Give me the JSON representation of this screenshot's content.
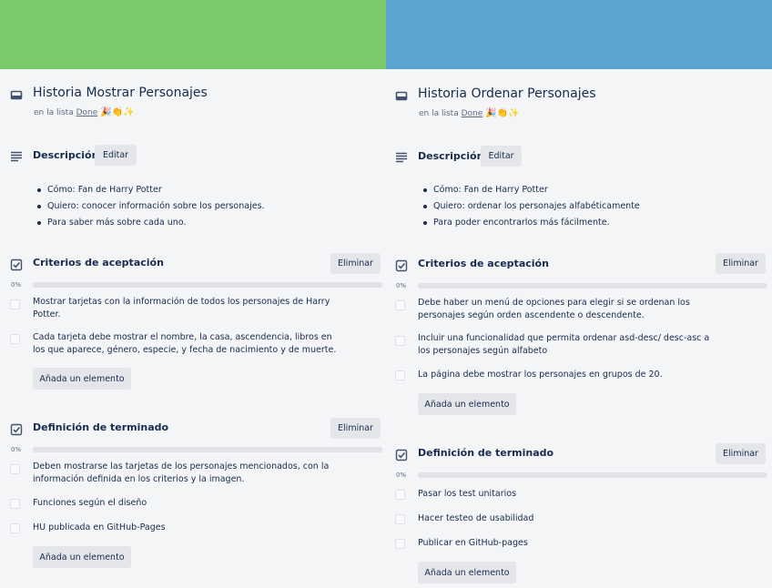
{
  "colors": {
    "left_cover": "#7ac96c",
    "right_cover": "#5ba4cf"
  },
  "cards": [
    {
      "title": "Historia Mostrar Personajes",
      "list_prefix": "en la lista",
      "list_name": "Done",
      "list_emojis": "🎉👏✨",
      "description": {
        "heading": "Descripción",
        "edit_label": "Editar",
        "items": [
          "Cómo: Fan de Harry Potter",
          "Quiero: conocer información sobre los personajes.",
          "Para saber más sobre cada uno."
        ]
      },
      "checklists": [
        {
          "title": "Criterios de aceptación",
          "delete_label": "Eliminar",
          "percent_label": "0%",
          "progress": 0,
          "items": [
            "Mostrar tarjetas con la información de todos los personajes de Harry\nPotter.",
            "Cada tarjeta debe mostrar el nombre, la casa, ascendencia, libros en\nlos que aparece, género, especie, y fecha de nacimiento y de muerte."
          ],
          "add_label": "Añada un elemento"
        },
        {
          "title": "Definición de terminado",
          "delete_label": "Eliminar",
          "percent_label": "0%",
          "progress": 0,
          "items": [
            "Deben mostrarse las tarjetas de los personajes mencionados, con la\ninformación definida en los criterios y la imagen.",
            "Funciones según el diseño",
            "HU publicada en GitHub-Pages"
          ],
          "add_label": "Añada un elemento"
        }
      ]
    },
    {
      "title": "Historia Ordenar Personajes",
      "list_prefix": "en la lista",
      "list_name": "Done",
      "list_emojis": "🎉👏✨",
      "description": {
        "heading": "Descripción",
        "edit_label": "Editar",
        "items": [
          "Cómo: Fan de Harry Potter",
          "Quiero: ordenar los personajes alfabéticamente",
          "Para poder encontrarlos más fácilmente."
        ]
      },
      "checklists": [
        {
          "title": "Criterios de aceptación",
          "delete_label": "Eliminar",
          "percent_label": "0%",
          "progress": 0,
          "items": [
            "Debe haber un menú de opciones para elegir si se ordenan los\npersonajes según orden ascendente o descendente.",
            "Incluir una funcionalidad que permita ordenar asd-desc/ desc-asc a\nlos personajes según alfabeto",
            "La página debe mostrar los personajes en grupos de 20."
          ],
          "add_label": "Añada un elemento"
        },
        {
          "title": "Definición de terminado",
          "delete_label": "Eliminar",
          "percent_label": "0%",
          "progress": 0,
          "items": [
            "Pasar los test unitarios",
            "Hacer testeo de usabilidad",
            "Publicar en GitHub-pages"
          ],
          "add_label": "Añada un elemento"
        }
      ]
    }
  ]
}
